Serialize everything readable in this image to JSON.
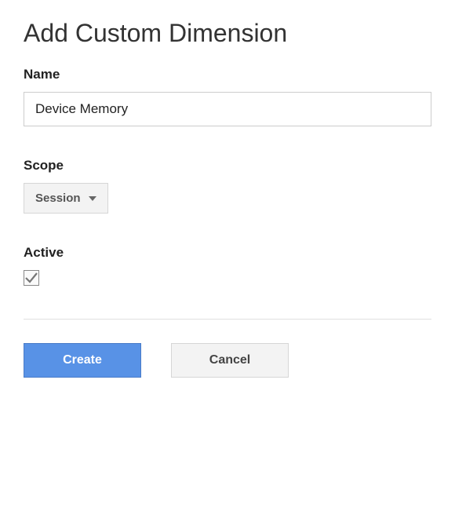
{
  "title": "Add Custom Dimension",
  "fields": {
    "name": {
      "label": "Name",
      "value": "Device Memory"
    },
    "scope": {
      "label": "Scope",
      "selected": "Session"
    },
    "active": {
      "label": "Active",
      "checked": true
    }
  },
  "buttons": {
    "create": "Create",
    "cancel": "Cancel"
  }
}
